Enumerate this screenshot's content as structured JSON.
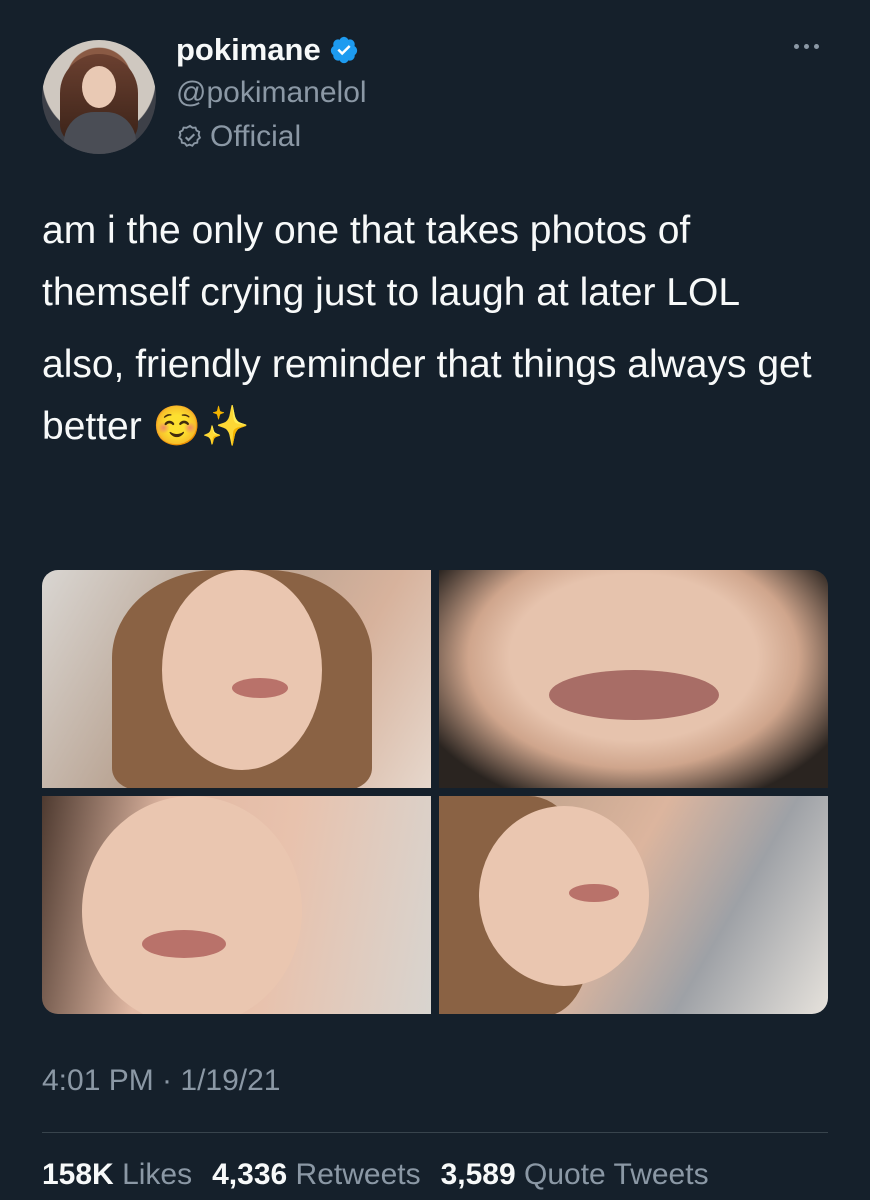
{
  "user": {
    "display_name": "pokimane",
    "handle": "@pokimanelol",
    "label": "Official",
    "verified_color": "#1d9bf0"
  },
  "tweet": {
    "paragraph_1": "am i the only one that takes photos of themself crying just to laugh at later LOL",
    "paragraph_2_text": "also, friendly reminder that things always get better ",
    "paragraph_2_emoji_1": "☺️",
    "paragraph_2_emoji_2": "✨",
    "timestamp": "4:01 PM · 1/19/21"
  },
  "media": {
    "count": 4
  },
  "stats": {
    "likes_count": "158K",
    "likes_label": "Likes",
    "retweets_count": "4,336",
    "retweets_label": "Retweets",
    "quotes_count": "3,589",
    "quotes_label": "Quote Tweets"
  },
  "colors": {
    "background": "#15202b",
    "text_primary": "#f7f9f9",
    "text_secondary": "#8b98a5",
    "divider": "#38444d"
  }
}
